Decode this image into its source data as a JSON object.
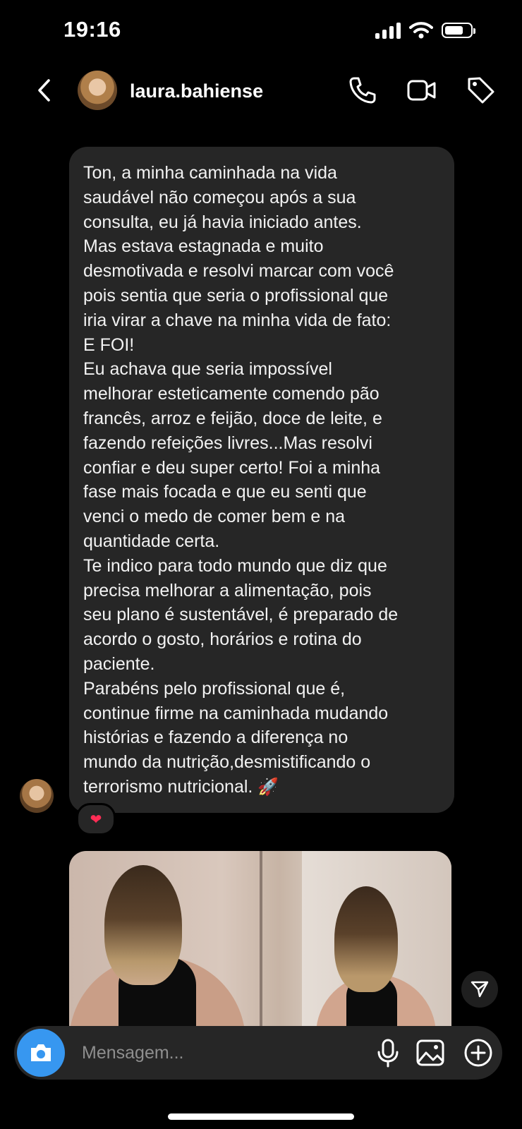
{
  "status_bar": {
    "time": "19:16"
  },
  "header": {
    "username": "laura.bahiense"
  },
  "message": {
    "text": "Ton, a minha caminhada na vida\nsaudável não começou após a sua\nconsulta, eu já havia iniciado antes.\nMas estava estagnada e muito\ndesmotivada e resolvi marcar com você\npois sentia que seria o profissional que\niria virar a chave na minha vida de fato:\nE FOI!\nEu achava que seria impossível\nmelhorar esteticamente comendo pão\nfrancês, arroz e feijão, doce de leite, e\nfazendo refeições livres...Mas resolvi\nconfiar e deu super certo! Foi a minha\nfase mais focada e que eu senti que\nvenci o medo de comer bem e na\nquantidade certa.\nTe indico para todo mundo que diz que\nprecisa melhorar a alimentação, pois\nseu plano é sustentável, é preparado de\nacordo o gosto, horários e rotina do\npaciente.\nParabéns pelo profissional que é,\ncontinue firme na caminhada mudando\nhistórias e fazendo a diferença no\nmundo da nutrição,desmistificando o\nterrorismo nutricional. ",
    "emoji": "🚀",
    "reaction": "❤"
  },
  "composer": {
    "placeholder": "Mensagem..."
  },
  "icons": {
    "back": "chevron-left-icon",
    "call": "phone-icon",
    "video": "video-camera-icon",
    "tag": "tag-icon",
    "share": "send-icon",
    "camera": "camera-icon",
    "mic": "microphone-icon",
    "gallery": "image-icon",
    "plus": "plus-circle-icon"
  },
  "colors": {
    "background": "#000000",
    "bubble": "#262626",
    "accent": "#3797f0",
    "reaction": "#ff2d55"
  }
}
